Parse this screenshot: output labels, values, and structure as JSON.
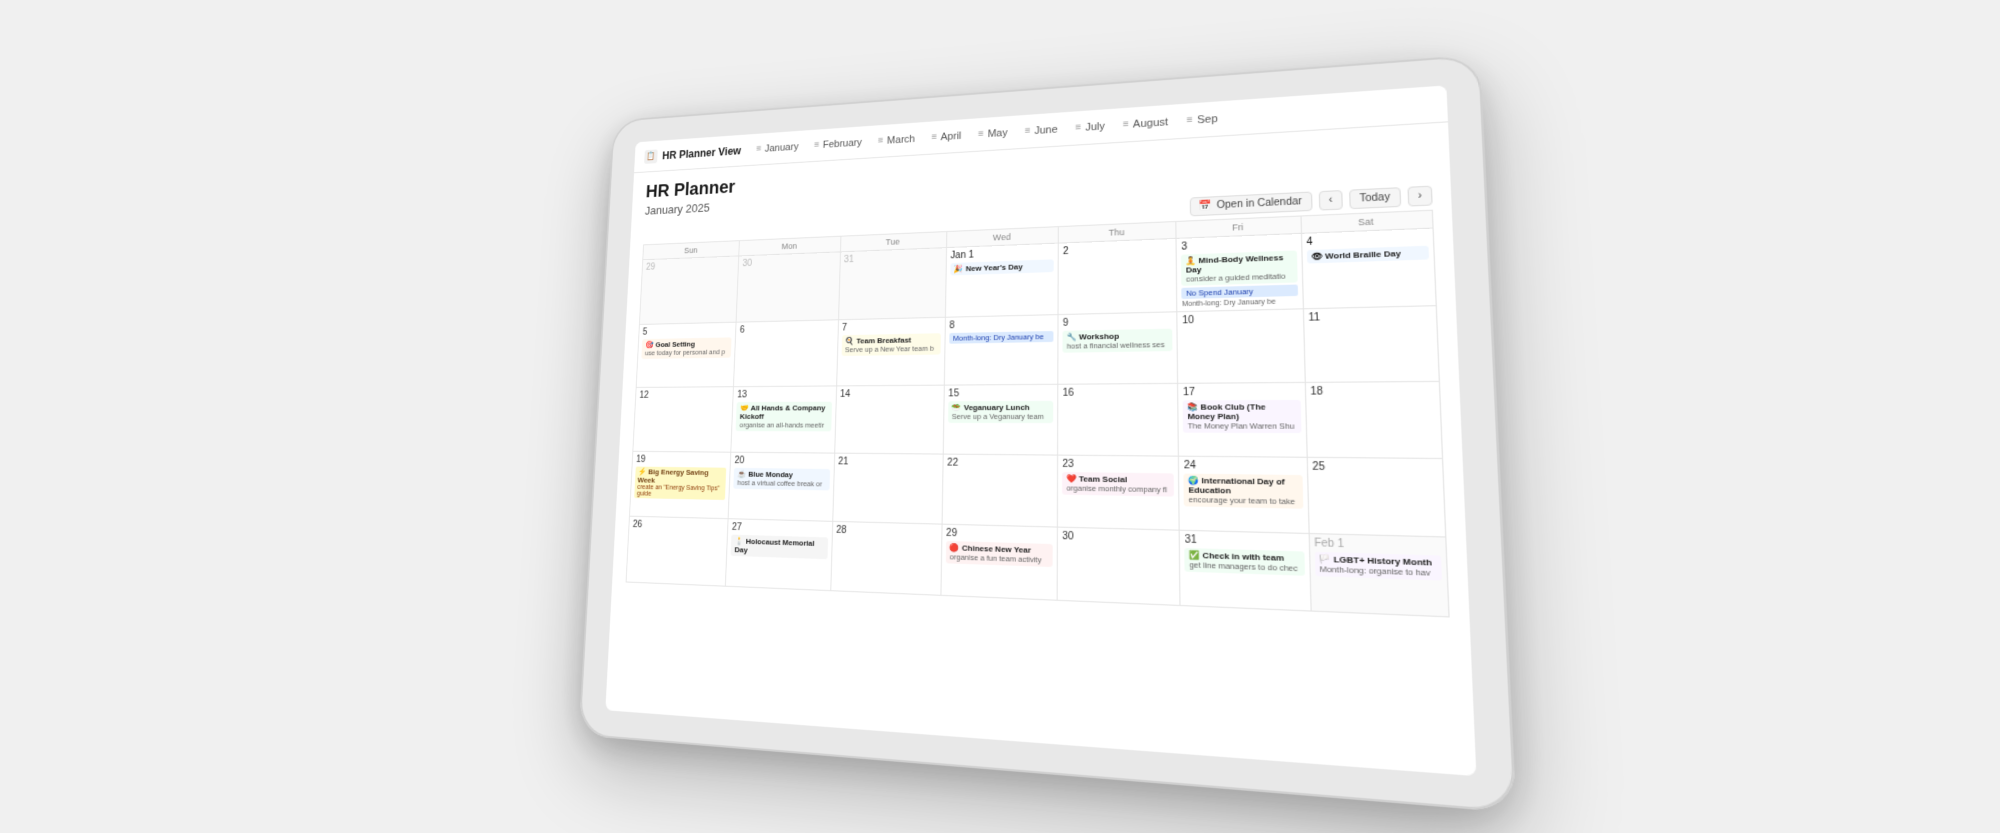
{
  "app": {
    "icon": "📋",
    "title": "HR Planner View"
  },
  "tabs": [
    {
      "label": "January",
      "icon": "≡"
    },
    {
      "label": "February",
      "icon": "≡"
    },
    {
      "label": "March",
      "icon": "≡"
    },
    {
      "label": "April",
      "icon": "≡"
    },
    {
      "label": "May",
      "icon": "≡"
    },
    {
      "label": "June",
      "icon": "≡"
    },
    {
      "label": "July",
      "icon": "≡"
    },
    {
      "label": "August",
      "icon": "≡"
    },
    {
      "label": "Sep",
      "icon": "≡"
    }
  ],
  "page": {
    "title": "HR Planner",
    "subtitle": "January 2025"
  },
  "toolbar": {
    "open_calendar": "Open in Calendar",
    "today": "Today"
  },
  "calendar": {
    "headers": [
      "Sun",
      "Mon",
      "Tue",
      "Wed",
      "Thu",
      "Fri",
      "Sat"
    ],
    "weeks": [
      {
        "days": [
          {
            "date": "29",
            "outside": true,
            "events": []
          },
          {
            "date": "30",
            "outside": true,
            "events": []
          },
          {
            "date": "31",
            "outside": true,
            "events": []
          },
          {
            "date": "Jan 1",
            "outside": false,
            "events": [
              {
                "icon": "🎉",
                "title": "New Year's Day",
                "type": "blue"
              }
            ]
          },
          {
            "date": "2",
            "outside": false,
            "events": []
          },
          {
            "date": "3",
            "outside": false,
            "events": [
              {
                "icon": "🧘",
                "title": "Mind-Body Wellness Day",
                "desc": "consider a guided meditatio",
                "type": "green"
              },
              {
                "month_long": true,
                "title": "No Spend January",
                "color": ""
              }
            ]
          },
          {
            "date": "4",
            "outside": false,
            "events": [
              {
                "icon": "👁️",
                "title": "World Braille Day",
                "type": "blue"
              }
            ]
          }
        ]
      },
      {
        "days": [
          {
            "date": "5",
            "outside": false,
            "events": [
              {
                "icon": "🎯",
                "title": "Goal Setting",
                "desc": "use today for personal and p",
                "type": "orange"
              }
            ]
          },
          {
            "date": "6",
            "outside": false,
            "events": []
          },
          {
            "date": "7",
            "outside": false,
            "events": [
              {
                "icon": "🍳",
                "title": "Team Breakfast",
                "desc": "Serve up a New Year team b",
                "type": "yellow"
              }
            ]
          },
          {
            "date": "8",
            "outside": false,
            "events": [
              {
                "month_long": true,
                "title": "Month-long: Dry January be",
                "color": "blue"
              }
            ]
          },
          {
            "date": "9",
            "outside": false,
            "events": [
              {
                "icon": "🔧",
                "title": "Workshop",
                "desc": "host a financial wellness ses",
                "type": "teal"
              }
            ]
          },
          {
            "date": "10",
            "outside": false,
            "events": []
          },
          {
            "date": "11",
            "outside": false,
            "events": []
          }
        ]
      },
      {
        "days": [
          {
            "date": "12",
            "outside": false,
            "events": []
          },
          {
            "date": "13",
            "outside": false,
            "events": [
              {
                "icon": "🤝",
                "title": "All Hands & Company Kickoff",
                "desc": "organise an all-hands meetir",
                "type": "green"
              }
            ]
          },
          {
            "date": "14",
            "outside": false,
            "events": []
          },
          {
            "date": "15",
            "outside": false,
            "events": [
              {
                "icon": "🥗",
                "title": "Veganuary Lunch",
                "desc": "Serve up a Veganuary team",
                "type": "green"
              }
            ]
          },
          {
            "date": "16",
            "outside": false,
            "events": []
          },
          {
            "date": "17",
            "outside": false,
            "events": [
              {
                "icon": "📚",
                "title": "Book Club (The Money Plan)",
                "desc": "The Money Plan Warren Shu",
                "type": "purple"
              }
            ]
          },
          {
            "date": "18",
            "outside": false,
            "events": []
          }
        ]
      },
      {
        "days": [
          {
            "date": "19",
            "outside": false,
            "events": [
              {
                "icon": "⚡",
                "title": "Big Energy Saving Week",
                "desc": "create an 'Energy Saving Tips' guide",
                "type": "yellow",
                "week_event": true
              }
            ]
          },
          {
            "date": "20",
            "outside": false,
            "events": [
              {
                "icon": "☕",
                "title": "Blue Monday",
                "desc": "host a virtual coffee break or",
                "type": "blue"
              }
            ]
          },
          {
            "date": "21",
            "outside": false,
            "events": []
          },
          {
            "date": "22",
            "outside": false,
            "events": []
          },
          {
            "date": "23",
            "outside": false,
            "events": [
              {
                "icon": "❤️",
                "title": "Team Social",
                "desc": "organise monthly company fl",
                "type": "pink"
              }
            ]
          },
          {
            "date": "24",
            "outside": false,
            "events": [
              {
                "icon": "🌍",
                "title": "International Day of Education",
                "desc": "encourage your team to take",
                "type": "orange"
              }
            ]
          },
          {
            "date": "25",
            "outside": false,
            "events": []
          }
        ]
      },
      {
        "days": [
          {
            "date": "26",
            "outside": false,
            "events": []
          },
          {
            "date": "27",
            "outside": false,
            "events": [
              {
                "icon": "🕯️",
                "title": "Holocaust Memorial Day",
                "type": "gray"
              }
            ]
          },
          {
            "date": "28",
            "outside": false,
            "events": []
          },
          {
            "date": "29",
            "outside": false,
            "events": [
              {
                "icon": "🔴",
                "title": "Chinese New Year",
                "desc": "organise a fun team activity",
                "type": "red"
              }
            ]
          },
          {
            "date": "30",
            "outside": false,
            "events": []
          },
          {
            "date": "31",
            "outside": false,
            "events": [
              {
                "icon": "✅",
                "title": "Check in with team",
                "desc": "get line managers to do chec",
                "type": "green"
              }
            ]
          },
          {
            "date": "Feb 1",
            "outside": true,
            "events": [
              {
                "icon": "🏳️",
                "title": "LGBT+ History Month",
                "desc": "Month-long: organise to hav",
                "type": "purple"
              }
            ]
          }
        ]
      }
    ]
  }
}
